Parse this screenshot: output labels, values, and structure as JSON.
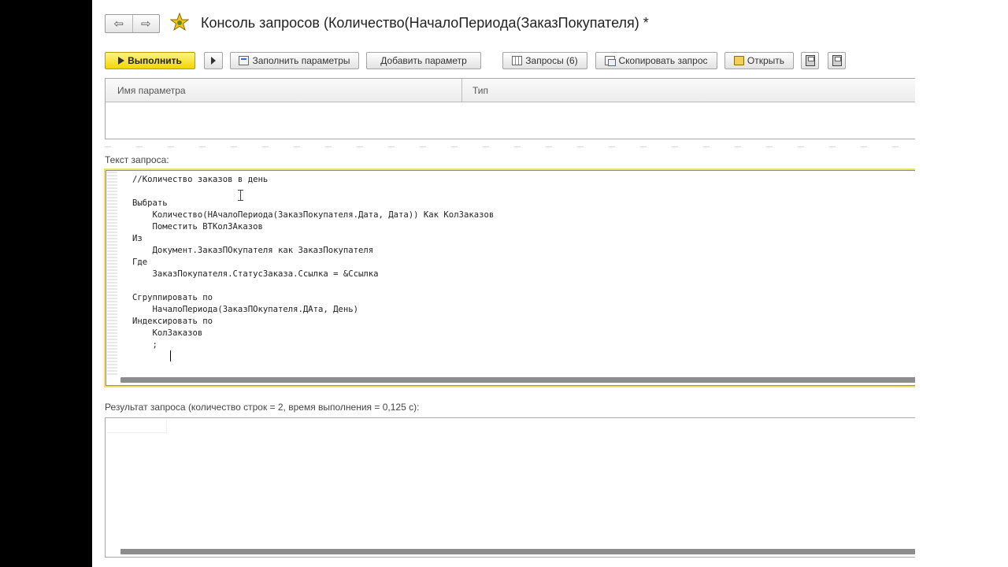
{
  "window": {
    "title": "Консоль запросов (Количество(НачалоПериода(ЗаказПокупателя) *",
    "back_glyph": "⇦",
    "forward_glyph": "⇨"
  },
  "toolbar": {
    "run_label": "Выполнить",
    "fill_params_label": "Заполнить параметры",
    "add_param_label": "Добавить параметр",
    "queries_label": "Запросы (6)",
    "copy_query_label": "Скопировать запрос",
    "open_label": "Открыть"
  },
  "params_table": {
    "columns": [
      "Имя параметра",
      "Тип"
    ]
  },
  "query": {
    "label": "Текст запроса:",
    "text": "//Количество заказов в день\n\nВыбрать\n    Количество(НАчалоПериода(ЗаказПокупателя.Дата, Дата)) Как КолЗаказов\n    Поместить ВТКолЗАказов\nИз\n    Документ.ЗаказПОкупателя как ЗаказПокупателя\nГде\n    ЗаказПокупателя.СтатусЗаказа.Ссылка = &Ссылка\n\nСгруппировать по\n    НачалоПериода(ЗаказПОкупателя.ДАта, День)\nИндексировать по\n    КолЗаказов\n    ;"
  },
  "result": {
    "label": "Результат запроса (количество строк = 2, время выполнения = 0,125 с):"
  },
  "colors": {
    "primary_button": "#f2d600",
    "editor_focus_border": "#f0dd6a"
  }
}
